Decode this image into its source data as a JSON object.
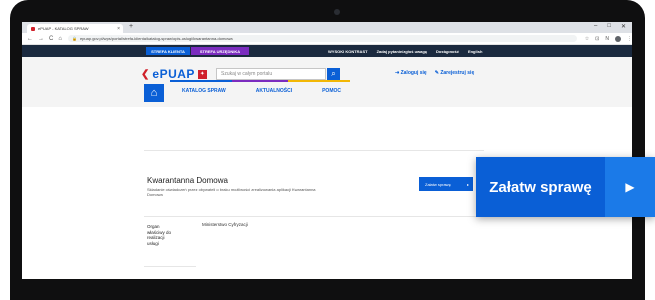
{
  "browser": {
    "tab_title": "ePUAP - KATALOG SPRAW",
    "new_tab_icon": "plus-icon",
    "window_controls": [
      "–",
      "□",
      "✕"
    ],
    "nav": [
      "←",
      "→",
      "C",
      "⌂"
    ],
    "url": "epuap.gov.pl/wps/portal/strefa-klienta/katalog-spraw/opis-uslugi/kwarantanna-domowa",
    "toolbar_icons": [
      "☆",
      "⊡",
      "N"
    ]
  },
  "site_topnav": {
    "client_zone": "STREFA KLIENTA",
    "office_zone": "STREFA URZĘDNIKA",
    "links": [
      "WYSOKI KONTRAST",
      "Zadaj pytanie/zgłoś uwagę",
      "Dostępność",
      "English"
    ]
  },
  "header": {
    "logo_text": "ePUAP",
    "search_placeholder": "Szukaj w całym portalu",
    "login": "Zaloguj się",
    "register": "Zarejestruj się"
  },
  "main_nav": [
    "KATALOG SPRAW",
    "AKTUALNOŚCI",
    "POMOC"
  ],
  "service": {
    "title": "Kwarantanna Domowa",
    "description": "Składanie oświadczeń przez obywateli o braku możliwości zrealizowania aplikacji Kwarantanna Domowa",
    "button": "Załatw sprawę",
    "org_label": "Organ właściwy do realizacji usługi",
    "org_value": "Ministerstwo Cyfryzacji"
  },
  "cta": {
    "label": "Załatw sprawę",
    "arrow_icon": "play-icon"
  },
  "colors": {
    "brand_blue": "#0a5fd6",
    "office_purple": "#7b2cbf",
    "accent_red": "#d0202a",
    "accent_yellow": "#f2b705",
    "topnav_dark": "#1b2a3f"
  }
}
